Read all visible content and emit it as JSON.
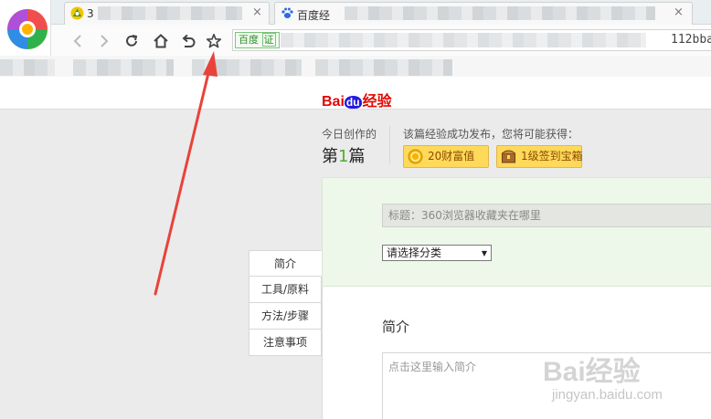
{
  "browser": {
    "tabs": [
      {
        "title": "3",
        "close": "×"
      },
      {
        "title": "百度经",
        "close": "×"
      }
    ],
    "address_site_label": "百度",
    "address_verified_badge": "证",
    "address_url_tail": "112bba"
  },
  "brand": {
    "bai": "Bai",
    "du": "du",
    "suffix": "经验"
  },
  "stats": {
    "today_label": "今日创作的",
    "count_prefix": "第",
    "count_value": "1",
    "count_suffix": "篇"
  },
  "reward": {
    "text": "该篇经验成功发布，您将可能获得：",
    "badges": [
      "20财富值",
      "1级签到宝箱"
    ]
  },
  "form": {
    "title_value": "标题：360浏览器收藏夹在哪里",
    "category_select": "请选择分类",
    "intro_heading": "简介",
    "intro_placeholder": "点击这里输入简介"
  },
  "sidenav": [
    "简介",
    "工具/原料",
    "方法/步骤",
    "注意事项"
  ],
  "watermark": {
    "logo": "Bai经验",
    "url": "jingyan.baidu.com"
  },
  "colors": {
    "arrow": "#e8433a",
    "accent_green": "#4caf2b",
    "badge_yellow": "#ffd95a",
    "form_green": "#edf7ea"
  },
  "icons": [
    "browser-logo-icon",
    "back-icon",
    "forward-icon",
    "refresh-icon",
    "home-icon",
    "undo-icon",
    "star-icon",
    "coin-icon",
    "chest-icon",
    "paw-icon"
  ]
}
